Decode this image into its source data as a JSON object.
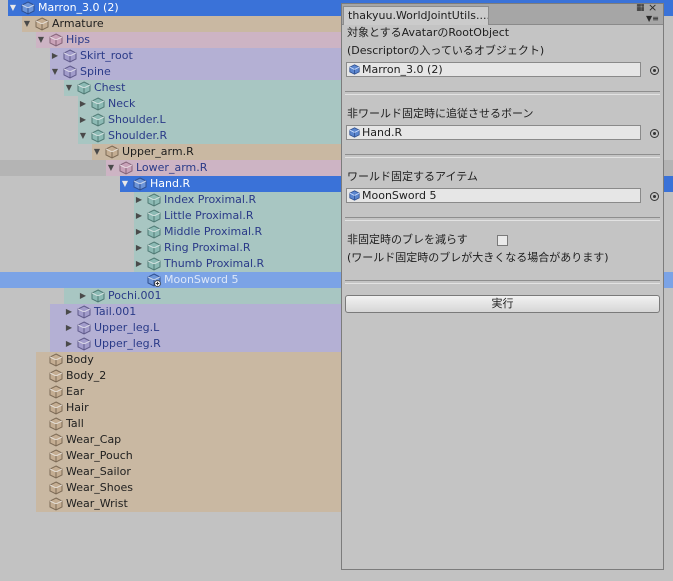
{
  "colors": {
    "selected": "#3a72d8",
    "selected_soft": "#7ba3e6",
    "orange": "#c9b8a2",
    "pink": "#cdb4c4",
    "lavender": "#b4b0d4",
    "teal": "#a8c6c2",
    "row_hover": "#b4b4b4"
  },
  "hierarchy": [
    {
      "label": "Marron_3.0 (2)",
      "depth": 0,
      "arrow": "down",
      "color": "selected",
      "cube": "blue",
      "start": 8
    },
    {
      "label": "Armature",
      "depth": 1,
      "arrow": "down",
      "color": "orange",
      "cube": "tan",
      "start": 22
    },
    {
      "label": "Hips",
      "depth": 2,
      "arrow": "down",
      "color": "pink",
      "cube": "pink",
      "start": 36
    },
    {
      "label": "Skirt_root",
      "depth": 3,
      "arrow": "right",
      "color": "lavender",
      "cube": "lavender",
      "start": 50
    },
    {
      "label": "Spine",
      "depth": 3,
      "arrow": "down",
      "color": "lavender",
      "cube": "lavender",
      "start": 50
    },
    {
      "label": "Chest",
      "depth": 4,
      "arrow": "down",
      "color": "teal",
      "cube": "teal",
      "start": 64
    },
    {
      "label": "Neck",
      "depth": 5,
      "arrow": "right",
      "color": "teal",
      "cube": "teal",
      "start": 78
    },
    {
      "label": "Shoulder.L",
      "depth": 5,
      "arrow": "right",
      "color": "teal",
      "cube": "teal",
      "start": 78
    },
    {
      "label": "Shoulder.R",
      "depth": 5,
      "arrow": "down",
      "color": "teal",
      "cube": "teal",
      "start": 78
    },
    {
      "label": "Upper_arm.R",
      "depth": 6,
      "arrow": "down",
      "color": "orange",
      "cube": "tan",
      "start": 92
    },
    {
      "label": "Lower_arm.R",
      "depth": 7,
      "arrow": "down",
      "color": "pink",
      "cube": "pink",
      "start": 106,
      "hover": true
    },
    {
      "label": "Hand.R",
      "depth": 8,
      "arrow": "down",
      "color": "selected",
      "cube": "blue",
      "start": 120
    },
    {
      "label": "Index Proximal.R",
      "depth": 9,
      "arrow": "right",
      "color": "teal",
      "cube": "teal",
      "start": 134
    },
    {
      "label": "Little Proximal.R",
      "depth": 9,
      "arrow": "right",
      "color": "teal",
      "cube": "teal",
      "start": 134
    },
    {
      "label": "Middle Proximal.R",
      "depth": 9,
      "arrow": "right",
      "color": "teal",
      "cube": "teal",
      "start": 134
    },
    {
      "label": "Ring Proximal.R",
      "depth": 9,
      "arrow": "right",
      "color": "teal",
      "cube": "teal",
      "start": 134
    },
    {
      "label": "Thumb Proximal.R",
      "depth": 9,
      "arrow": "right",
      "color": "teal",
      "cube": "teal",
      "start": 134
    },
    {
      "label": "MoonSword 5",
      "depth": 9,
      "arrow": "none",
      "color": "selected_soft",
      "cube": "blue",
      "start": 0,
      "plus": true
    },
    {
      "label": "Pochi.001",
      "depth": 5,
      "arrow": "right",
      "color": "teal",
      "cube": "teal",
      "start": 64
    },
    {
      "label": "Tail.001",
      "depth": 4,
      "arrow": "right",
      "color": "lavender",
      "cube": "lavender",
      "start": 50
    },
    {
      "label": "Upper_leg.L",
      "depth": 4,
      "arrow": "right",
      "color": "lavender",
      "cube": "lavender",
      "start": 50
    },
    {
      "label": "Upper_leg.R",
      "depth": 4,
      "arrow": "right",
      "color": "lavender",
      "cube": "lavender",
      "start": 50
    },
    {
      "label": "Body",
      "depth": 2,
      "arrow": "none",
      "color": "orange",
      "cube": "tan",
      "start": 36
    },
    {
      "label": "Body_2",
      "depth": 2,
      "arrow": "none",
      "color": "orange",
      "cube": "tan",
      "start": 36
    },
    {
      "label": "Ear",
      "depth": 2,
      "arrow": "none",
      "color": "orange",
      "cube": "tan",
      "start": 36
    },
    {
      "label": "Hair",
      "depth": 2,
      "arrow": "none",
      "color": "orange",
      "cube": "tan",
      "start": 36
    },
    {
      "label": "Tall",
      "depth": 2,
      "arrow": "none",
      "color": "orange",
      "cube": "tan",
      "start": 36
    },
    {
      "label": "Wear_Cap",
      "depth": 2,
      "arrow": "none",
      "color": "orange",
      "cube": "tan",
      "start": 36
    },
    {
      "label": "Wear_Pouch",
      "depth": 2,
      "arrow": "none",
      "color": "orange",
      "cube": "tan",
      "start": 36
    },
    {
      "label": "Wear_Sailor",
      "depth": 2,
      "arrow": "none",
      "color": "orange",
      "cube": "tan",
      "start": 36
    },
    {
      "label": "Wear_Shoes",
      "depth": 2,
      "arrow": "none",
      "color": "orange",
      "cube": "tan",
      "start": 36
    },
    {
      "label": "Wear_Wrist",
      "depth": 2,
      "arrow": "none",
      "color": "orange",
      "cube": "tan",
      "start": 36
    }
  ],
  "panel": {
    "tab_title": "thakyuu.WorldJointUtils....",
    "section1_line1": "対象とするAvatarのRootObject",
    "section1_line2": "(Descriptorの入っているオブジェクト)",
    "field1_value": "Marron_3.0 (2)",
    "section2_label": "非ワールド固定時に追従させるボーン",
    "field2_value": "Hand.R",
    "section3_label": "ワールド固定するアイテム",
    "field3_value": "MoonSword 5",
    "checkbox_label": "非固定時のブレを減らす",
    "checkbox_checked": false,
    "note": "(ワールド固定時のブレが大きくなる場合があります)",
    "exec_label": "実行",
    "lock_icon": "lock-icon",
    "menu_icon": "menu-icon"
  }
}
